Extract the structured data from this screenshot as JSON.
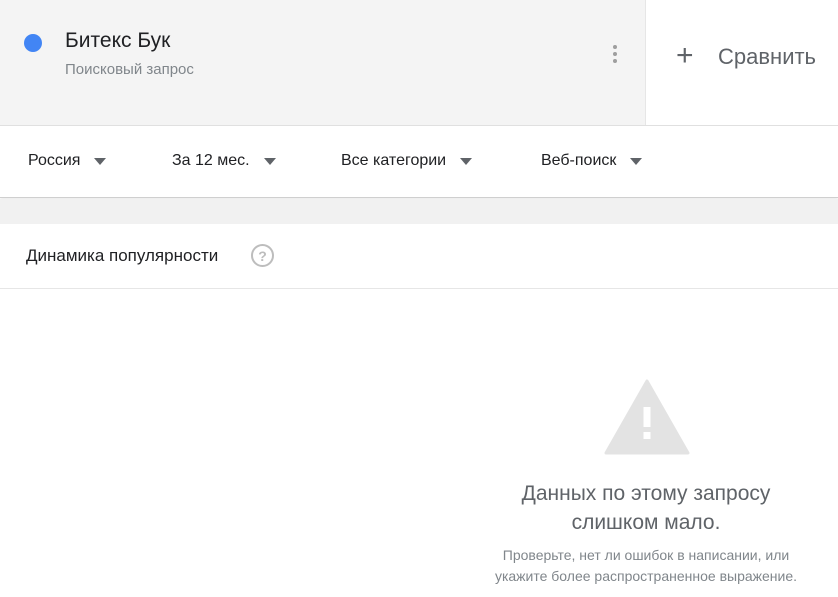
{
  "term": {
    "name": "Битекс Бук",
    "type": "Поисковый запрос",
    "color": "#4285f4"
  },
  "compare": {
    "icon": "plus-icon",
    "plus_glyph": "+",
    "label": "Сравнить"
  },
  "filters": [
    {
      "label": "Россия"
    },
    {
      "label": "За 12 мес."
    },
    {
      "label": "Все категории"
    },
    {
      "label": "Веб-поиск"
    }
  ],
  "panel": {
    "title": "Динамика популярности",
    "help_glyph": "?"
  },
  "empty_state": {
    "icon": "warning-icon",
    "title_line1": "Данных по этому запросу",
    "title_line2": "слишком мало.",
    "hint_line1": "Проверьте, нет ли ошибок в написании, или",
    "hint_line2": "укажите более распространенное выражение."
  }
}
